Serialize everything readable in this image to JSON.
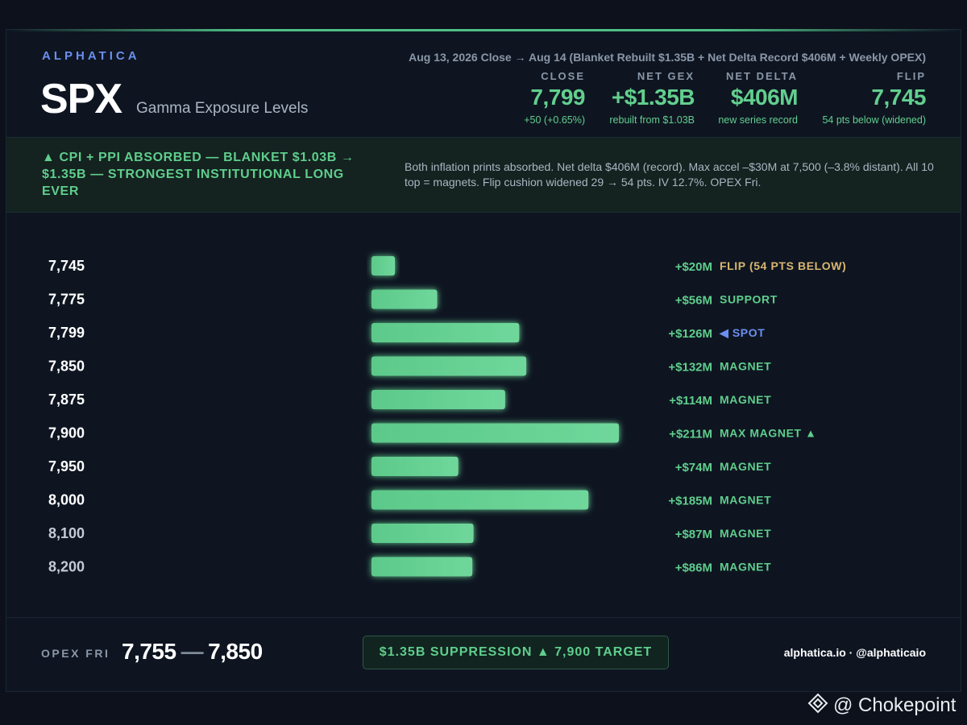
{
  "brand": "ALPHATICA",
  "ticker": "SPX",
  "subtitle": "Gamma Exposure Levels",
  "dateline": "Aug 13, 2026 Close → Aug 14 (Blanket Rebuilt $1.35B + Net Delta Record $406M + Weekly OPEX)",
  "stats": [
    {
      "label": "CLOSE",
      "value": "7,799",
      "note": "+50 (+0.65%)"
    },
    {
      "label": "NET GEX",
      "value": "+$1.35B",
      "note": "rebuilt from $1.03B"
    },
    {
      "label": "NET DELTA",
      "value": "$406M",
      "note": "new series record"
    },
    {
      "label": "FLIP",
      "value": "7,745",
      "note": "54 pts below (widened)"
    }
  ],
  "banner": {
    "headline": "▲ CPI + PPI ABSORBED — BLANKET $1.03B → $1.35B — STRONGEST INSTITUTIONAL LONG EVER",
    "body": "Both inflation prints absorbed. Net delta $406M (record). Max accel –$30M at 7,500 (–3.8% distant). All 10 top = magnets. Flip cushion widened 29 → 54 pts. IV 12.7%. OPEX Fri."
  },
  "chart_data": {
    "type": "bar",
    "orientation": "horizontal",
    "categories": [
      "7,745",
      "7,775",
      "7,799",
      "7,850",
      "7,875",
      "7,900",
      "7,950",
      "8,000",
      "8,100",
      "8,200"
    ],
    "values": [
      20,
      56,
      126,
      132,
      114,
      211,
      74,
      185,
      87,
      86
    ],
    "value_labels": [
      "+$20M",
      "+$56M",
      "+$126M",
      "+$132M",
      "+$114M",
      "+$211M",
      "+$74M",
      "+$185M",
      "+$87M",
      "+$86M"
    ],
    "tags": [
      "FLIP (54 PTS BELOW)",
      "SUPPORT",
      "◀ SPOT",
      "MAGNET",
      "MAGNET",
      "MAX MAGNET ▲",
      "MAGNET",
      "MAGNET",
      "MAGNET",
      "MAGNET"
    ],
    "tag_colors": [
      "#d9b670",
      "#5fce8c",
      "#6b8ff0",
      "#5fce8c",
      "#5fce8c",
      "#5fce8c",
      "#5fce8c",
      "#5fce8c",
      "#5fce8c",
      "#5fce8c"
    ],
    "strike_colors": [
      "#ffffff",
      "#ffffff",
      "#ffffff",
      "#ffffff",
      "#ffffff",
      "#ffffff",
      "#ffffff",
      "#ffffff",
      "#c3cbd6",
      "#c3cbd6"
    ],
    "unit": "$M",
    "bar_color": "#5fce8c",
    "xlim": [
      0,
      211
    ]
  },
  "footer": {
    "opex_label": "OPEX FRI",
    "range_low": "7,755",
    "range_dash": "—",
    "range_high": "7,850",
    "pill": "$1.35B SUPPRESSION ▲ 7,900 TARGET",
    "site": "alphatica.io · @alphaticaio"
  },
  "watermark": "@ Chokepoint",
  "colors": {
    "accent_green": "#5fce8c",
    "accent_blue": "#6b8ff0",
    "flip_gold": "#d9b670",
    "background": "#0c111b"
  }
}
